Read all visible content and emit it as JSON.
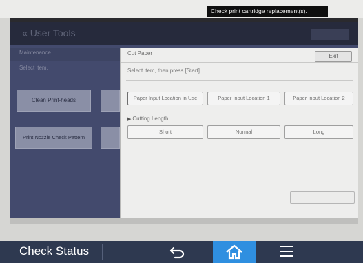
{
  "notice": {
    "text": "Check print cartridge replacement(s)."
  },
  "background": {
    "title": "User Tools",
    "subtitle": "Maintenance",
    "instruction": "Select item.",
    "buttons": [
      "Clean Print-heads",
      "Print Nozzle Check Pattern"
    ]
  },
  "dialog": {
    "title": "Cut Paper",
    "exit_label": "Exit",
    "instruction": "Select item, then press [Start].",
    "input_locations": [
      {
        "label": "Paper Input Location in Use",
        "selected": true
      },
      {
        "label": "Paper Input Location 1",
        "selected": false
      },
      {
        "label": "Paper Input Location 2",
        "selected": false
      }
    ],
    "cutting_length_label": "Cutting Length",
    "cutting_lengths": [
      {
        "label": "Short"
      },
      {
        "label": "Normal"
      },
      {
        "label": "Long"
      }
    ]
  },
  "navbar": {
    "status_label": "Check Status",
    "back_icon": "back-arrow-icon",
    "home_icon": "home-icon",
    "menu_icon": "menu-icon"
  },
  "colors": {
    "navbar": "#2e3950",
    "home_active": "#2f8fe0",
    "overlay_panel": "#434a6d",
    "dialog": "#eeeeed"
  }
}
